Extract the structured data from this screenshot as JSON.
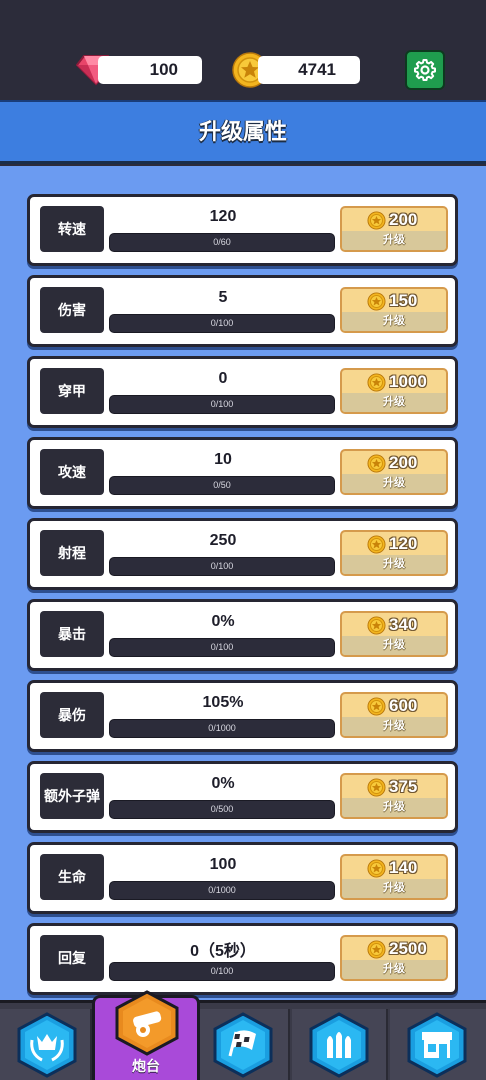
{
  "resources": {
    "gems": "100",
    "coins": "4741"
  },
  "title": "升级属性",
  "colors": {
    "accent_blue": "#3d7ee0",
    "background_blue": "#6b9bf1",
    "nav_active": "#a94ad9",
    "button_gold": "#f7d78f"
  },
  "upgrades": [
    {
      "name": "转速",
      "value": "120",
      "progress": "0/60",
      "fill": 0,
      "cost": "200",
      "action": "升级"
    },
    {
      "name": "伤害",
      "value": "5",
      "progress": "0/100",
      "fill": 0,
      "cost": "150",
      "action": "升级"
    },
    {
      "name": "穿甲",
      "value": "0",
      "progress": "0/100",
      "fill": 0,
      "cost": "1000",
      "action": "升级"
    },
    {
      "name": "攻速",
      "value": "10",
      "progress": "0/50",
      "fill": 0,
      "cost": "200",
      "action": "升级"
    },
    {
      "name": "射程",
      "value": "250",
      "progress": "0/100",
      "fill": 0,
      "cost": "120",
      "action": "升级"
    },
    {
      "name": "暴击",
      "value": "0%",
      "progress": "0/100",
      "fill": 0,
      "cost": "340",
      "action": "升级"
    },
    {
      "name": "暴伤",
      "value": "105%",
      "progress": "0/1000",
      "fill": 0,
      "cost": "600",
      "action": "升级"
    },
    {
      "name": "额外子弹",
      "value": "0%",
      "progress": "0/500",
      "fill": 0,
      "cost": "375",
      "action": "升级"
    },
    {
      "name": "生命",
      "value": "100",
      "progress": "0/1000",
      "fill": 0,
      "cost": "140",
      "action": "升级"
    },
    {
      "name": "回复",
      "value": "0（5秒）",
      "progress": "0/100",
      "fill": 0,
      "cost": "2500",
      "action": "升级"
    }
  ],
  "nav": {
    "active_label": "炮台",
    "items": [
      "crown-laurel-icon",
      "cannon-icon",
      "checkered-flag-icon",
      "bullets-icon",
      "shop-icon"
    ]
  }
}
